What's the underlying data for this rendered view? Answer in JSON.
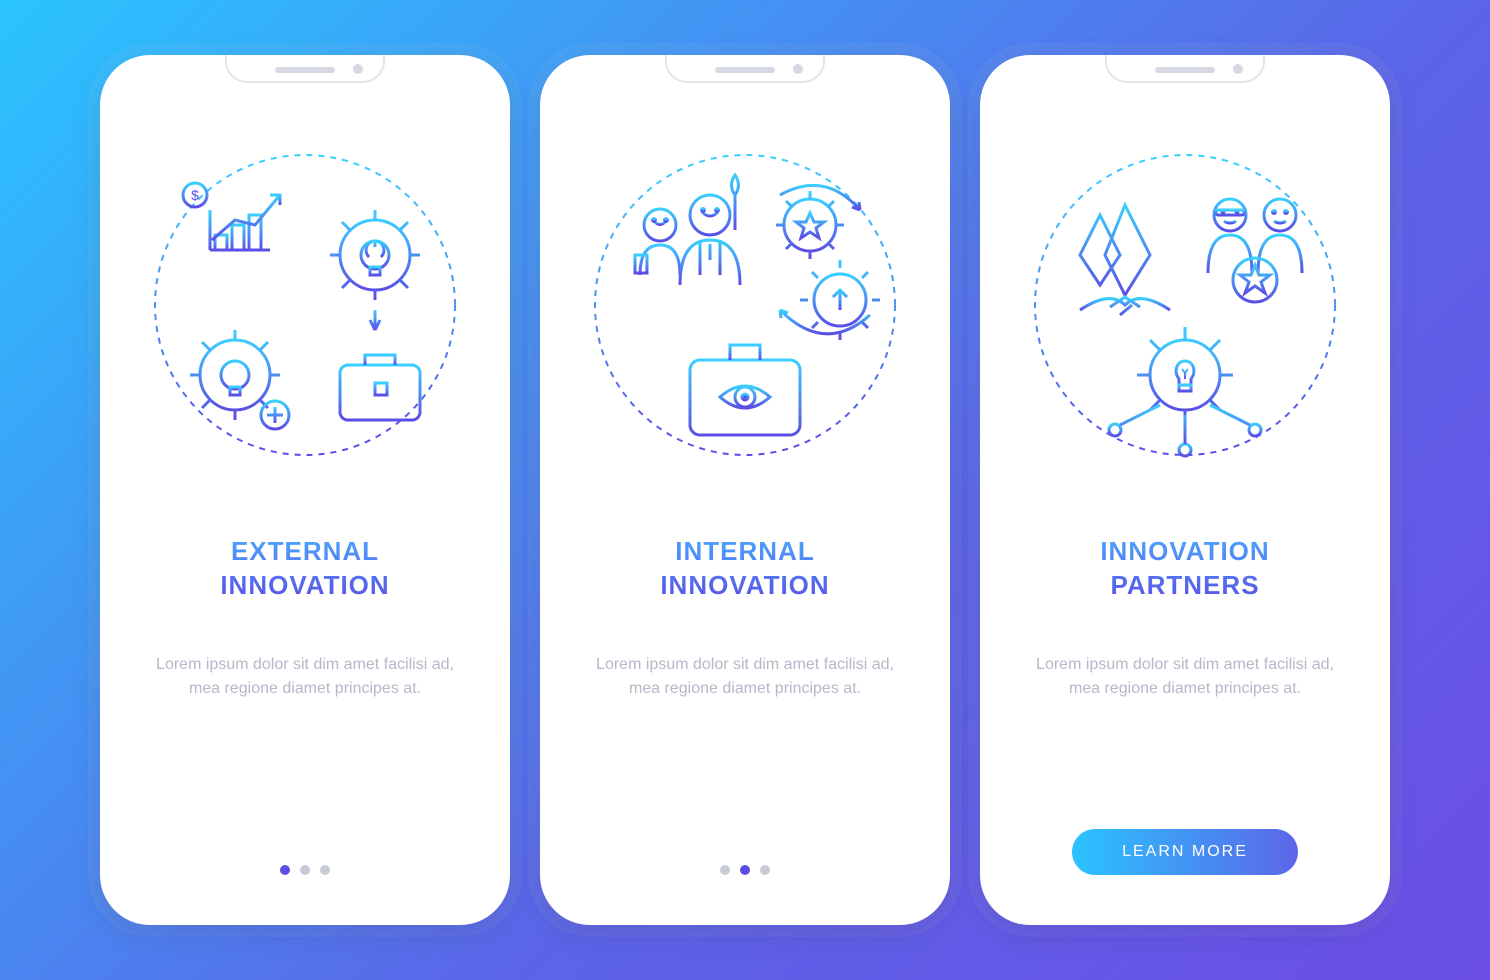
{
  "screens": [
    {
      "title": "EXTERNAL\nINNOVATION",
      "description": "Lorem ipsum dolor sit dim amet facilisi ad, mea regione diamet principes at.",
      "active_dot": 0
    },
    {
      "title": "INTERNAL\nINNOVATION",
      "description": "Lorem ipsum dolor sit dim amet facilisi ad, mea regione diamet principes at.",
      "active_dot": 1
    },
    {
      "title": "INNOVATION\nPARTNERS",
      "description": "Lorem ipsum dolor sit dim amet facilisi ad, mea regione diamet principes at.",
      "button_label": "LEARN MORE"
    }
  ],
  "colors": {
    "grad_top": "#3acfff",
    "grad_bottom": "#5b4ee6"
  }
}
